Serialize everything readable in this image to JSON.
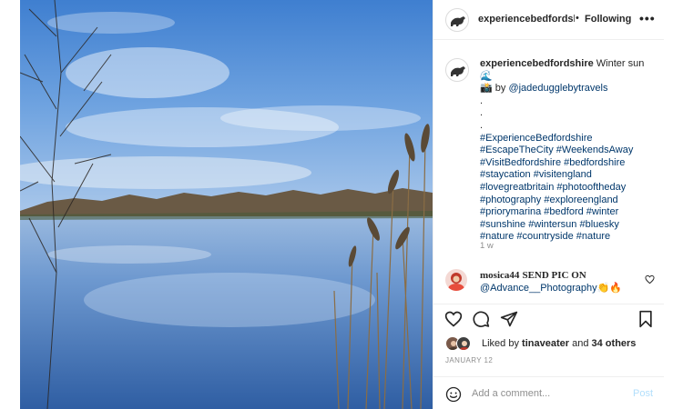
{
  "post": {
    "image_alt": "Lake with winter sun, blue sky, reeds and bare trees",
    "image_icon": "lake-photo"
  },
  "header": {
    "username": "experiencebedfordshire",
    "separator": "•",
    "follow_label": "Following",
    "more_icon": "more-options-icon",
    "more_glyph": "•••"
  },
  "caption": {
    "username": "experiencebedfordshire",
    "text_part1": "Winter sun 🌊",
    "text_part2": "📸 by",
    "mention": "@jadedugglebytravels",
    "dots": [
      ".",
      ".",
      "."
    ],
    "hashtag_lines": [
      "#ExperienceBedfordshire",
      "#EscapeTheCity #WeekendsAway",
      "#VisitBedfordshire #bedfordshire",
      "#staycation #visitengland",
      "#lovegreatbritain #photooftheday",
      "#photography #exploreengland",
      "#priorymarina #bedford #winter",
      "#sunshine #wintersun #bluesky",
      "#nature #countryside #nature"
    ],
    "time_ago": "1 w"
  },
  "comment": {
    "username": "mosica44",
    "text": "SEND PIC ON",
    "mention": "@Advance__Photography",
    "emojis": "👏🔥"
  },
  "actions": {
    "like_icon": "heart-icon",
    "comment_icon": "comment-icon",
    "share_icon": "share-icon",
    "save_icon": "bookmark-icon"
  },
  "likes": {
    "prefix": "Liked by",
    "user": "tinaveater",
    "conjunction": "and",
    "others": "34 others"
  },
  "date": "JANUARY 12",
  "add_comment": {
    "placeholder": "Add a comment...",
    "post_label": "Post"
  },
  "colors": {
    "link": "#00376b",
    "muted": "#8e8e8e",
    "post_disabled": "#b2dffc",
    "border": "#efefef"
  }
}
